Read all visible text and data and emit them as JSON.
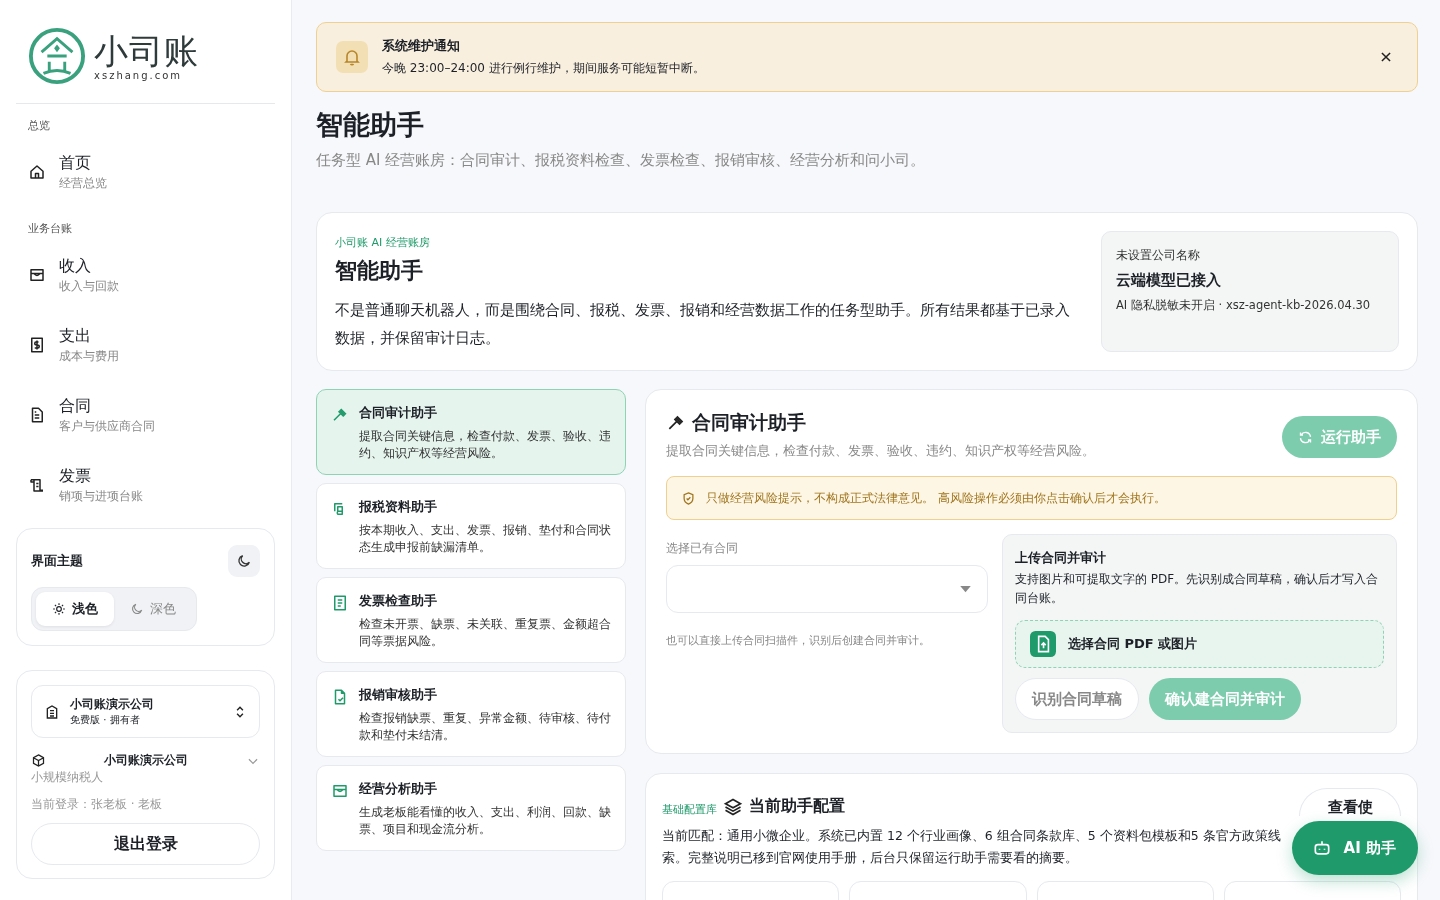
{
  "sidebar": {
    "logo": {
      "name": "小司账",
      "domain": "xszhang.com"
    },
    "sections": [
      {
        "title": "总览",
        "items": [
          {
            "label": "首页",
            "sub": "经营总览"
          }
        ]
      },
      {
        "title": "业务台账",
        "items": [
          {
            "label": "收入",
            "sub": "收入与回款"
          },
          {
            "label": "支出",
            "sub": "成本与费用"
          },
          {
            "label": "合同",
            "sub": "客户与供应商合同"
          },
          {
            "label": "发票",
            "sub": "销项与进项台账"
          }
        ]
      }
    ],
    "theme": {
      "title": "界面主题",
      "options": [
        {
          "label": "浅色",
          "selected": true
        },
        {
          "label": "深色",
          "selected": false
        }
      ]
    },
    "company": {
      "name": "小司账演示公司",
      "plan": "免费版 · 拥有者",
      "entity_name": "小司账演示公司",
      "entity_type": "小规模纳税人",
      "login": "当前登录：张老板 · 老板",
      "logout": "退出登录"
    }
  },
  "notice": {
    "title": "系统维护通知",
    "text": "今晚 23:00–24:00 进行例行维护，期间服务可能短暂中断。"
  },
  "page": {
    "title": "智能助手",
    "subtitle": "任务型 AI 经营账房：合同审计、报税资料检查、发票检查、报销审核、经营分析和问小司。"
  },
  "hero": {
    "eyebrow": "小司账 AI 经营账房",
    "title": "智能助手",
    "text": "不是普通聊天机器人，而是围绕合同、报税、发票、报销和经营数据工作的任务型助手。所有结果都基于已录入数据，并保留审计日志。",
    "status": {
      "company": "未设置公司名称",
      "title": "云端模型已接入",
      "detail": "AI 隐私脱敏未开启 · xsz-agent-kb-2026.04.30"
    }
  },
  "assistants": [
    {
      "title": "合同审计助手",
      "text": "提取合同关键信息，检查付款、发票、验收、违约、知识产权等经营风险。",
      "selected": true
    },
    {
      "title": "报税资料助手",
      "text": "按本期收入、支出、发票、报销、垫付和合同状态生成申报前缺漏清单。",
      "selected": false
    },
    {
      "title": "发票检查助手",
      "text": "检查未开票、缺票、未关联、重复票、金额超合同等票据风险。",
      "selected": false
    },
    {
      "title": "报销审核助手",
      "text": "检查报销缺票、重复、异常金额、待审核、待付款和垫付未结清。",
      "selected": false
    },
    {
      "title": "经营分析助手",
      "text": "生成老板能看懂的收入、支出、利润、回款、缺票、项目和现金流分析。",
      "selected": false
    }
  ],
  "detail": {
    "title": "合同审计助手",
    "text": "提取合同关键信息，检查付款、发票、验收、违约、知识产权等经营风险。",
    "run": "运行助手",
    "warning": "只做经营风险提示，不构成正式法律意见。 高风险操作必须由你点击确认后才会执行。",
    "select_label": "选择已有合同",
    "select_hint": "也可以直接上传合同扫描件，识别后创建合同并审计。",
    "upload": {
      "title": "上传合同并审计",
      "text": "支持图片和可提取文字的 PDF。先识别成合同草稿，确认后才写入合同台账。",
      "pick": "选择合同 PDF 或图片",
      "recognize": "识别合同草稿",
      "confirm": "确认建合同并审计"
    }
  },
  "config": {
    "tag": "基础配置库",
    "title": "当前助手配置",
    "text": "当前匹配：通用小微企业。系统已内置 12 个行业画像、6 组合同条款库、5 个资料包模板和5 条官方政策线索。完整说明已移到官网使用手册，后台只保留运行助手需要看的摘要。",
    "view": "查看使"
  },
  "fab": "AI 助手"
}
